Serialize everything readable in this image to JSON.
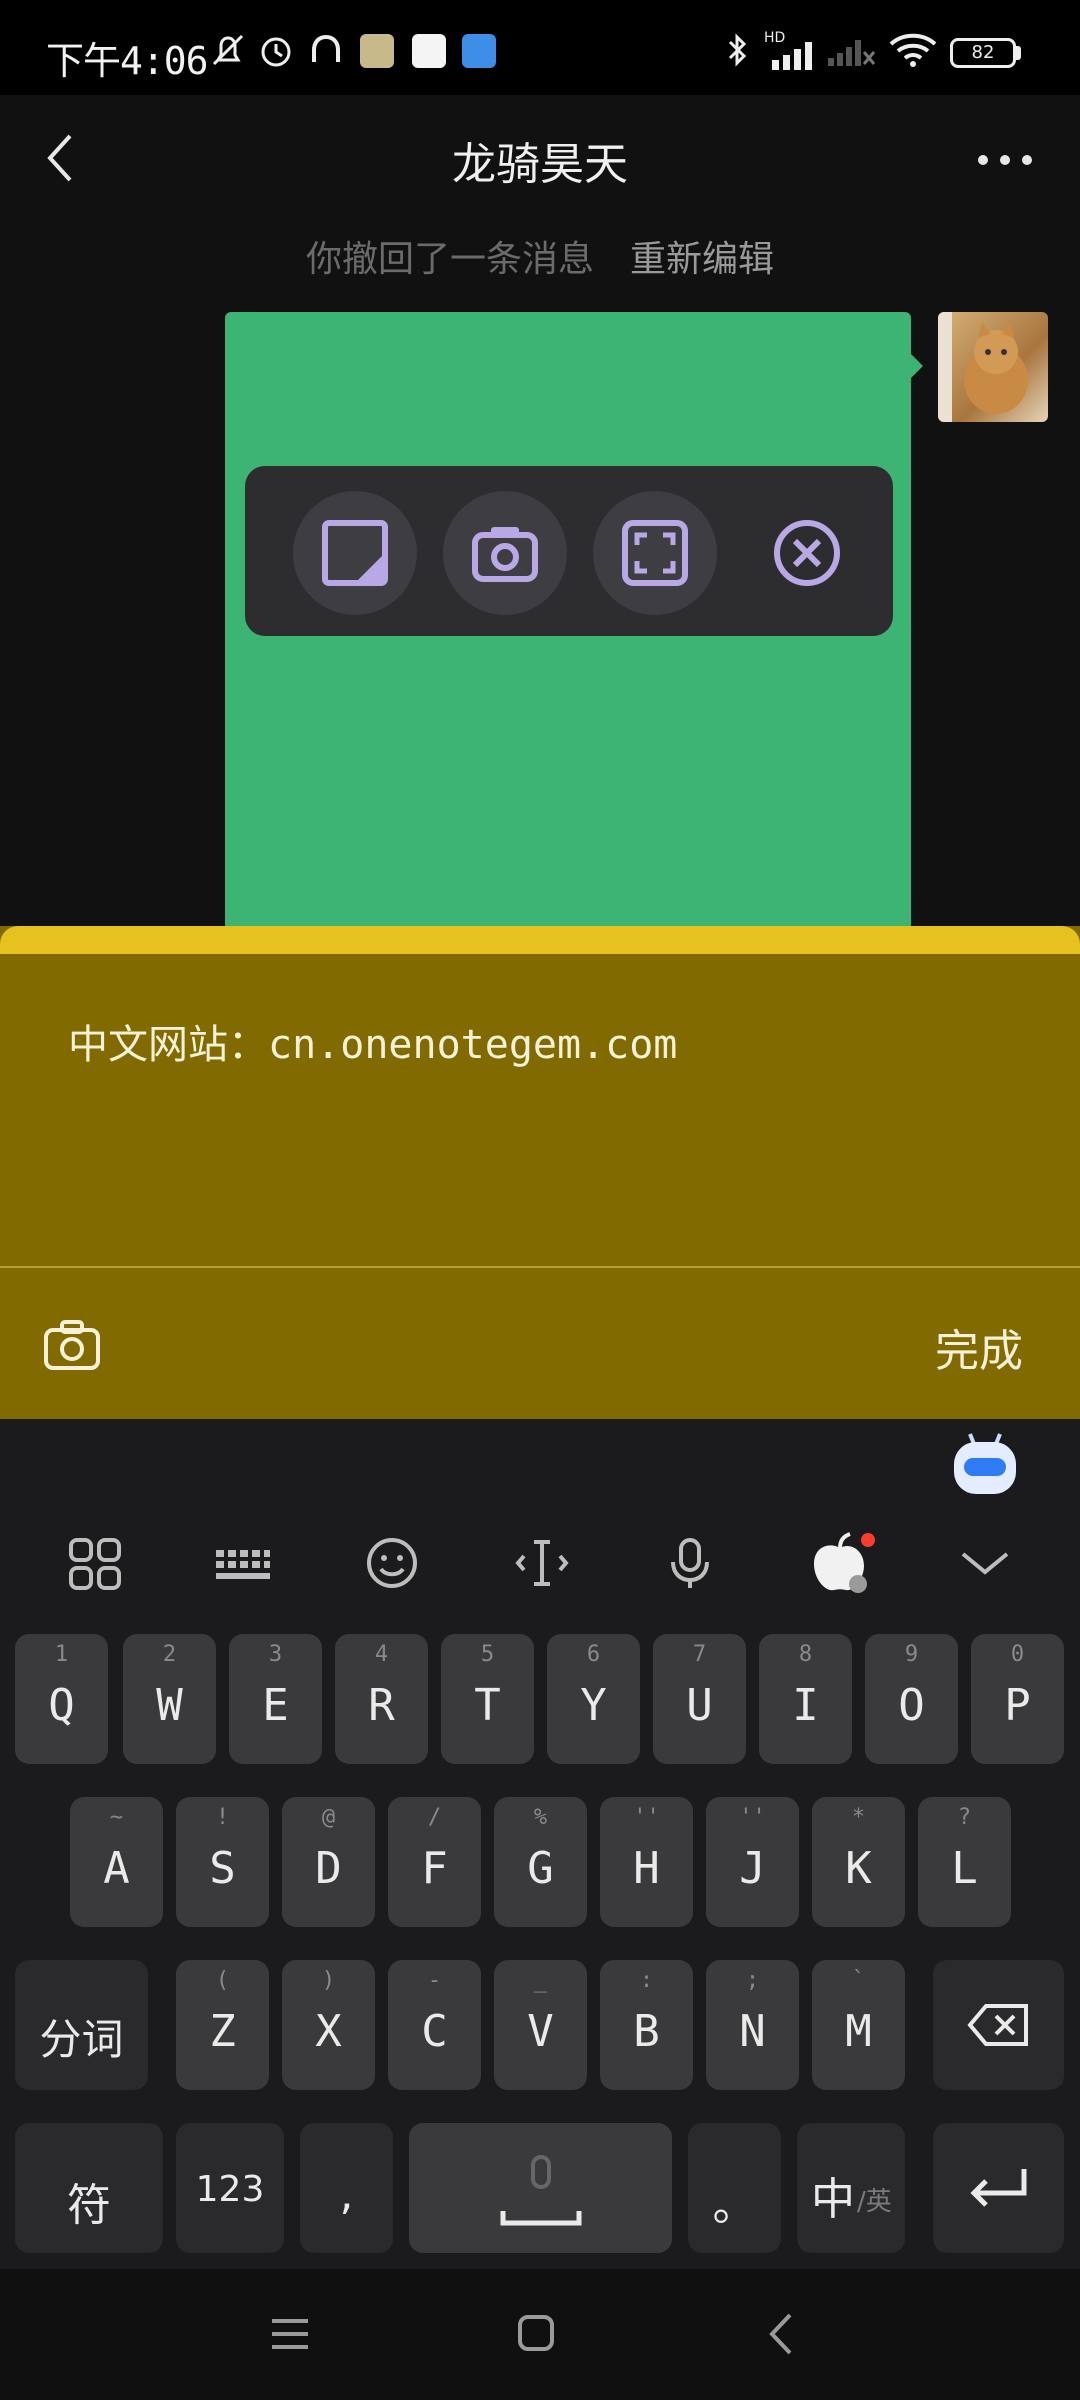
{
  "status_bar": {
    "time": "下午4:06",
    "battery": "82",
    "network_label": "HD"
  },
  "chat": {
    "title": "龙骑昊天",
    "recall_notice": "你撤回了一条消息",
    "recall_edit": "重新编辑"
  },
  "note": {
    "text": "中文网站：cn.onenotegem.com",
    "done_label": "完成"
  },
  "keyboard": {
    "row1": [
      {
        "main": "Q",
        "sub": "1"
      },
      {
        "main": "W",
        "sub": "2"
      },
      {
        "main": "E",
        "sub": "3"
      },
      {
        "main": "R",
        "sub": "4"
      },
      {
        "main": "T",
        "sub": "5"
      },
      {
        "main": "Y",
        "sub": "6"
      },
      {
        "main": "U",
        "sub": "7"
      },
      {
        "main": "I",
        "sub": "8"
      },
      {
        "main": "O",
        "sub": "9"
      },
      {
        "main": "P",
        "sub": "0"
      }
    ],
    "row2": [
      {
        "main": "A",
        "sub": "~"
      },
      {
        "main": "S",
        "sub": "!"
      },
      {
        "main": "D",
        "sub": "@"
      },
      {
        "main": "F",
        "sub": "/"
      },
      {
        "main": "G",
        "sub": "%"
      },
      {
        "main": "H",
        "sub": "''"
      },
      {
        "main": "J",
        "sub": "''"
      },
      {
        "main": "K",
        "sub": "*"
      },
      {
        "main": "L",
        "sub": "?"
      }
    ],
    "row3": [
      {
        "main": "Z",
        "sub": "("
      },
      {
        "main": "X",
        "sub": ")"
      },
      {
        "main": "C",
        "sub": "-"
      },
      {
        "main": "V",
        "sub": "_"
      },
      {
        "main": "B",
        "sub": ":"
      },
      {
        "main": "N",
        "sub": ";"
      },
      {
        "main": "M",
        "sub": "`"
      }
    ],
    "segment_label": "分词",
    "symbol_label": "符",
    "numbers_label": "123",
    "comma_label": ",",
    "period_label": "。",
    "lang_label_main": "中",
    "lang_label_sub": "/英"
  },
  "colors": {
    "bubble_green": "#3db374",
    "note_body": "#816b00",
    "note_strip": "#e6c21e",
    "key_bg": "#3a3a3c",
    "keyboard_bg": "#1b1b1d"
  }
}
